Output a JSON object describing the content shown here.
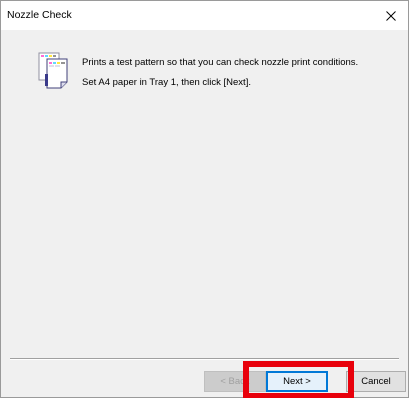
{
  "window": {
    "title": "Nozzle Check"
  },
  "content": {
    "icon": "printer-test-page-icon",
    "message_line1": "Prints a test pattern so that you can check nozzle print conditions.",
    "message_line2": "Set A4 paper in Tray 1, then click [Next]."
  },
  "buttons": {
    "back": "< Back",
    "next": "Next >",
    "cancel": "Cancel"
  },
  "colors": {
    "highlight": "#e8000b",
    "focus": "#0078d7",
    "dialog_bg": "#f0f0f0"
  }
}
